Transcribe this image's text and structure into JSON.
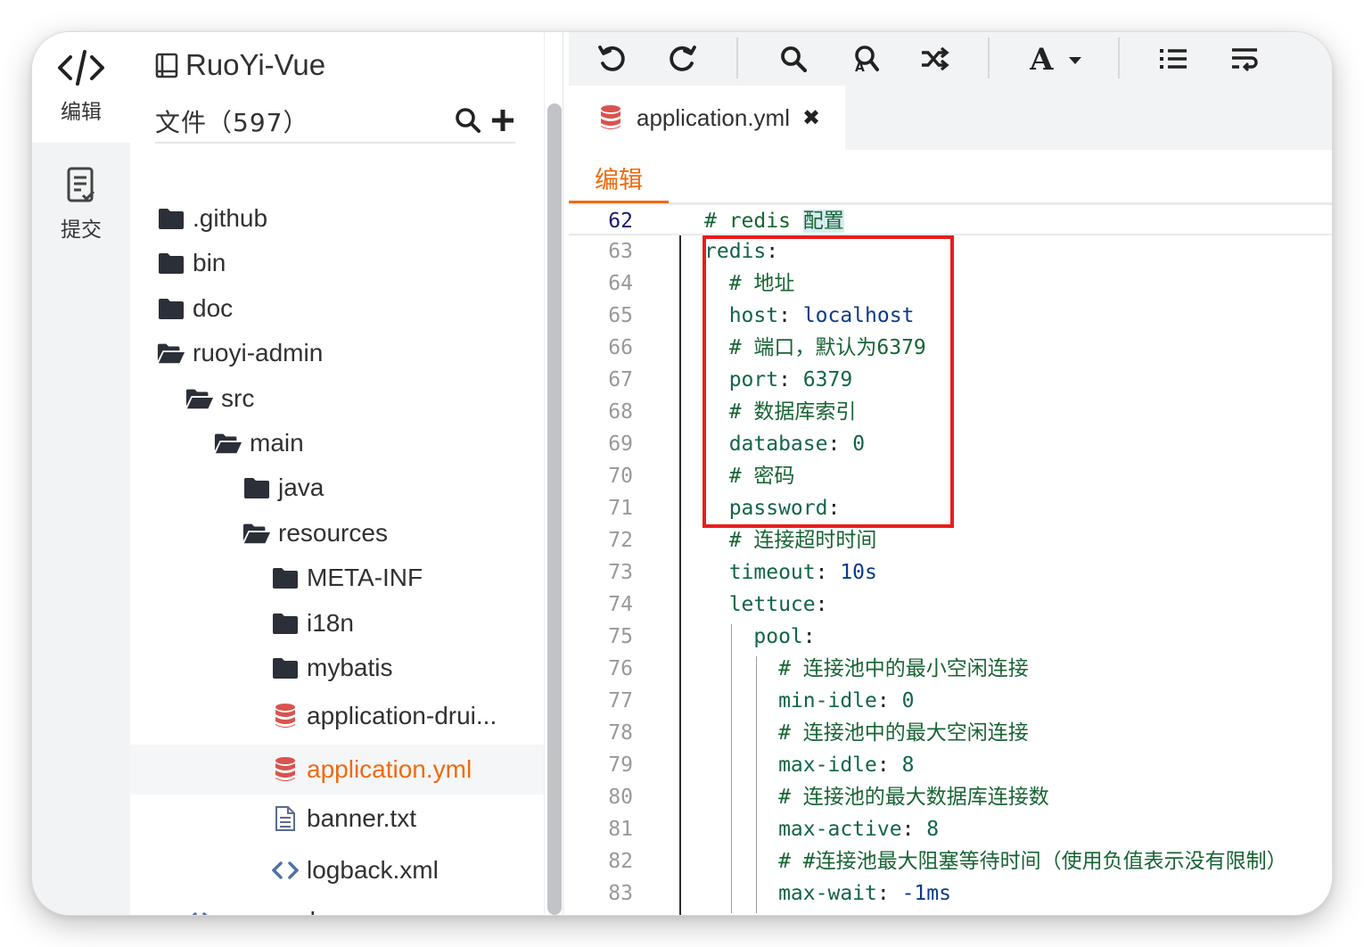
{
  "sidebar": {
    "edit_label": "编辑",
    "commit_label": "提交"
  },
  "explorer": {
    "repo_name": "RuoYi-Vue",
    "files_label": "文件（597）",
    "tree": [
      {
        "name": ".github",
        "type": "folder",
        "level": 0
      },
      {
        "name": "bin",
        "type": "folder",
        "level": 0
      },
      {
        "name": "doc",
        "type": "folder",
        "level": 0
      },
      {
        "name": "ruoyi-admin",
        "type": "folder-open",
        "level": 0
      },
      {
        "name": "src",
        "type": "folder-open",
        "level": 1
      },
      {
        "name": "main",
        "type": "folder-open",
        "level": 2
      },
      {
        "name": "java",
        "type": "folder",
        "level": 3
      },
      {
        "name": "resources",
        "type": "folder-open",
        "level": 3
      },
      {
        "name": "META-INF",
        "type": "folder",
        "level": 4
      },
      {
        "name": "i18n",
        "type": "folder",
        "level": 4
      },
      {
        "name": "mybatis",
        "type": "folder",
        "level": 4
      },
      {
        "name": "application-drui...",
        "type": "database",
        "level": 4
      },
      {
        "name": "application.yml",
        "type": "database",
        "level": 4,
        "selected": true
      },
      {
        "name": "banner.txt",
        "type": "text",
        "level": 4
      },
      {
        "name": "logback.xml",
        "type": "code",
        "level": 4
      },
      {
        "name": "pom.xml",
        "type": "code",
        "level": 1
      }
    ]
  },
  "editor": {
    "tab_label": "application.yml",
    "tab_close": "✖",
    "mode_label": "编辑",
    "lines": [
      {
        "n": "62",
        "segs": [
          [
            "c-comment",
            "# redis "
          ],
          [
            "c-comment c-hl",
            "配置"
          ]
        ],
        "current": true
      },
      {
        "n": "63",
        "segs": [
          [
            "c-key",
            "redis"
          ],
          [
            "c-punct",
            ":"
          ]
        ]
      },
      {
        "n": "64",
        "segs": [
          [
            "c-comment",
            "  # 地址"
          ]
        ]
      },
      {
        "n": "65",
        "segs": [
          [
            "c-key",
            "  host"
          ],
          [
            "c-punct",
            ": "
          ],
          [
            "c-str",
            "localhost"
          ]
        ]
      },
      {
        "n": "66",
        "segs": [
          [
            "c-comment",
            "  # 端口，默认为6379"
          ]
        ]
      },
      {
        "n": "67",
        "segs": [
          [
            "c-key",
            "  port"
          ],
          [
            "c-punct",
            ": "
          ],
          [
            "c-num",
            "6379"
          ]
        ]
      },
      {
        "n": "68",
        "segs": [
          [
            "c-comment",
            "  # 数据库索引"
          ]
        ]
      },
      {
        "n": "69",
        "segs": [
          [
            "c-key",
            "  database"
          ],
          [
            "c-punct",
            ": "
          ],
          [
            "c-num",
            "0"
          ]
        ]
      },
      {
        "n": "70",
        "segs": [
          [
            "c-comment",
            "  # 密码"
          ]
        ]
      },
      {
        "n": "71",
        "segs": [
          [
            "c-key",
            "  password"
          ],
          [
            "c-punct",
            ":"
          ]
        ]
      },
      {
        "n": "72",
        "segs": [
          [
            "c-comment",
            "  # 连接超时时间"
          ]
        ]
      },
      {
        "n": "73",
        "segs": [
          [
            "c-key",
            "  timeout"
          ],
          [
            "c-punct",
            ": "
          ],
          [
            "c-str",
            "10s"
          ]
        ]
      },
      {
        "n": "74",
        "segs": [
          [
            "c-key",
            "  lettuce"
          ],
          [
            "c-punct",
            ":"
          ]
        ]
      },
      {
        "n": "75",
        "segs": [
          [
            "c-key",
            "    pool"
          ],
          [
            "c-punct",
            ":"
          ]
        ]
      },
      {
        "n": "76",
        "segs": [
          [
            "c-comment",
            "      # 连接池中的最小空闲连接"
          ]
        ]
      },
      {
        "n": "77",
        "segs": [
          [
            "c-key",
            "      min-idle"
          ],
          [
            "c-punct",
            ": "
          ],
          [
            "c-num",
            "0"
          ]
        ]
      },
      {
        "n": "78",
        "segs": [
          [
            "c-comment",
            "      # 连接池中的最大空闲连接"
          ]
        ]
      },
      {
        "n": "79",
        "segs": [
          [
            "c-key",
            "      max-idle"
          ],
          [
            "c-punct",
            ": "
          ],
          [
            "c-num",
            "8"
          ]
        ]
      },
      {
        "n": "80",
        "segs": [
          [
            "c-comment",
            "      # 连接池的最大数据库连接数"
          ]
        ]
      },
      {
        "n": "81",
        "segs": [
          [
            "c-key",
            "      max-active"
          ],
          [
            "c-punct",
            ": "
          ],
          [
            "c-num",
            "8"
          ]
        ]
      },
      {
        "n": "82",
        "segs": [
          [
            "c-comment",
            "      # #连接池最大阻塞等待时间（使用负值表示没有限制）"
          ]
        ]
      },
      {
        "n": "83",
        "segs": [
          [
            "c-key",
            "      max-wait"
          ],
          [
            "c-punct",
            ": "
          ],
          [
            "c-str",
            "-1ms"
          ]
        ]
      }
    ]
  },
  "toolbar": {
    "icons": [
      "undo-icon",
      "redo-icon",
      "search-icon",
      "replace-icon",
      "shuffle-icon",
      "font-icon",
      "list-icon",
      "wrap-icon"
    ]
  },
  "colors": {
    "accent": "#f06a0f",
    "highlight_box": "#ea1c1c"
  }
}
